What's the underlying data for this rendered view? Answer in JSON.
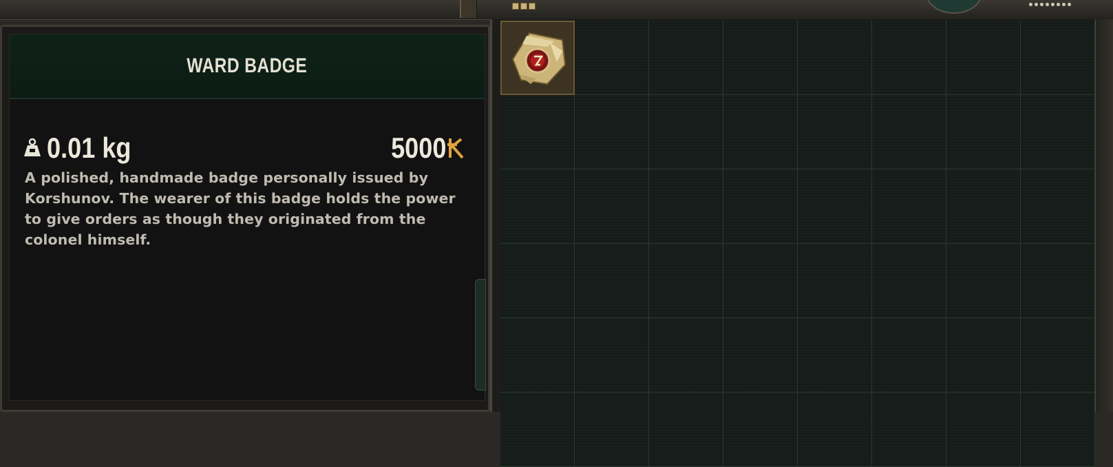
{
  "item": {
    "title": "WARD BADGE",
    "weight": "0.01 kg",
    "price": "5000",
    "description": "A polished, handmade badge personally issued by Korshunov. The wearer of this badge holds the power to give orders as though they originated from the colonel himself."
  },
  "icons": {
    "weight": "weight-icon",
    "currency": "coupon-currency-icon",
    "item": "ward-badge-icon"
  },
  "colors": {
    "header_bg": "#0f2219",
    "currency_accent": "#e2a23c",
    "text_primary": "#ece8dc",
    "text_secondary": "#bfbbb0",
    "grid_line": "#2a3a32"
  },
  "inventory": {
    "columns": 8,
    "visible_rows": 6,
    "occupied_slot": 0
  }
}
